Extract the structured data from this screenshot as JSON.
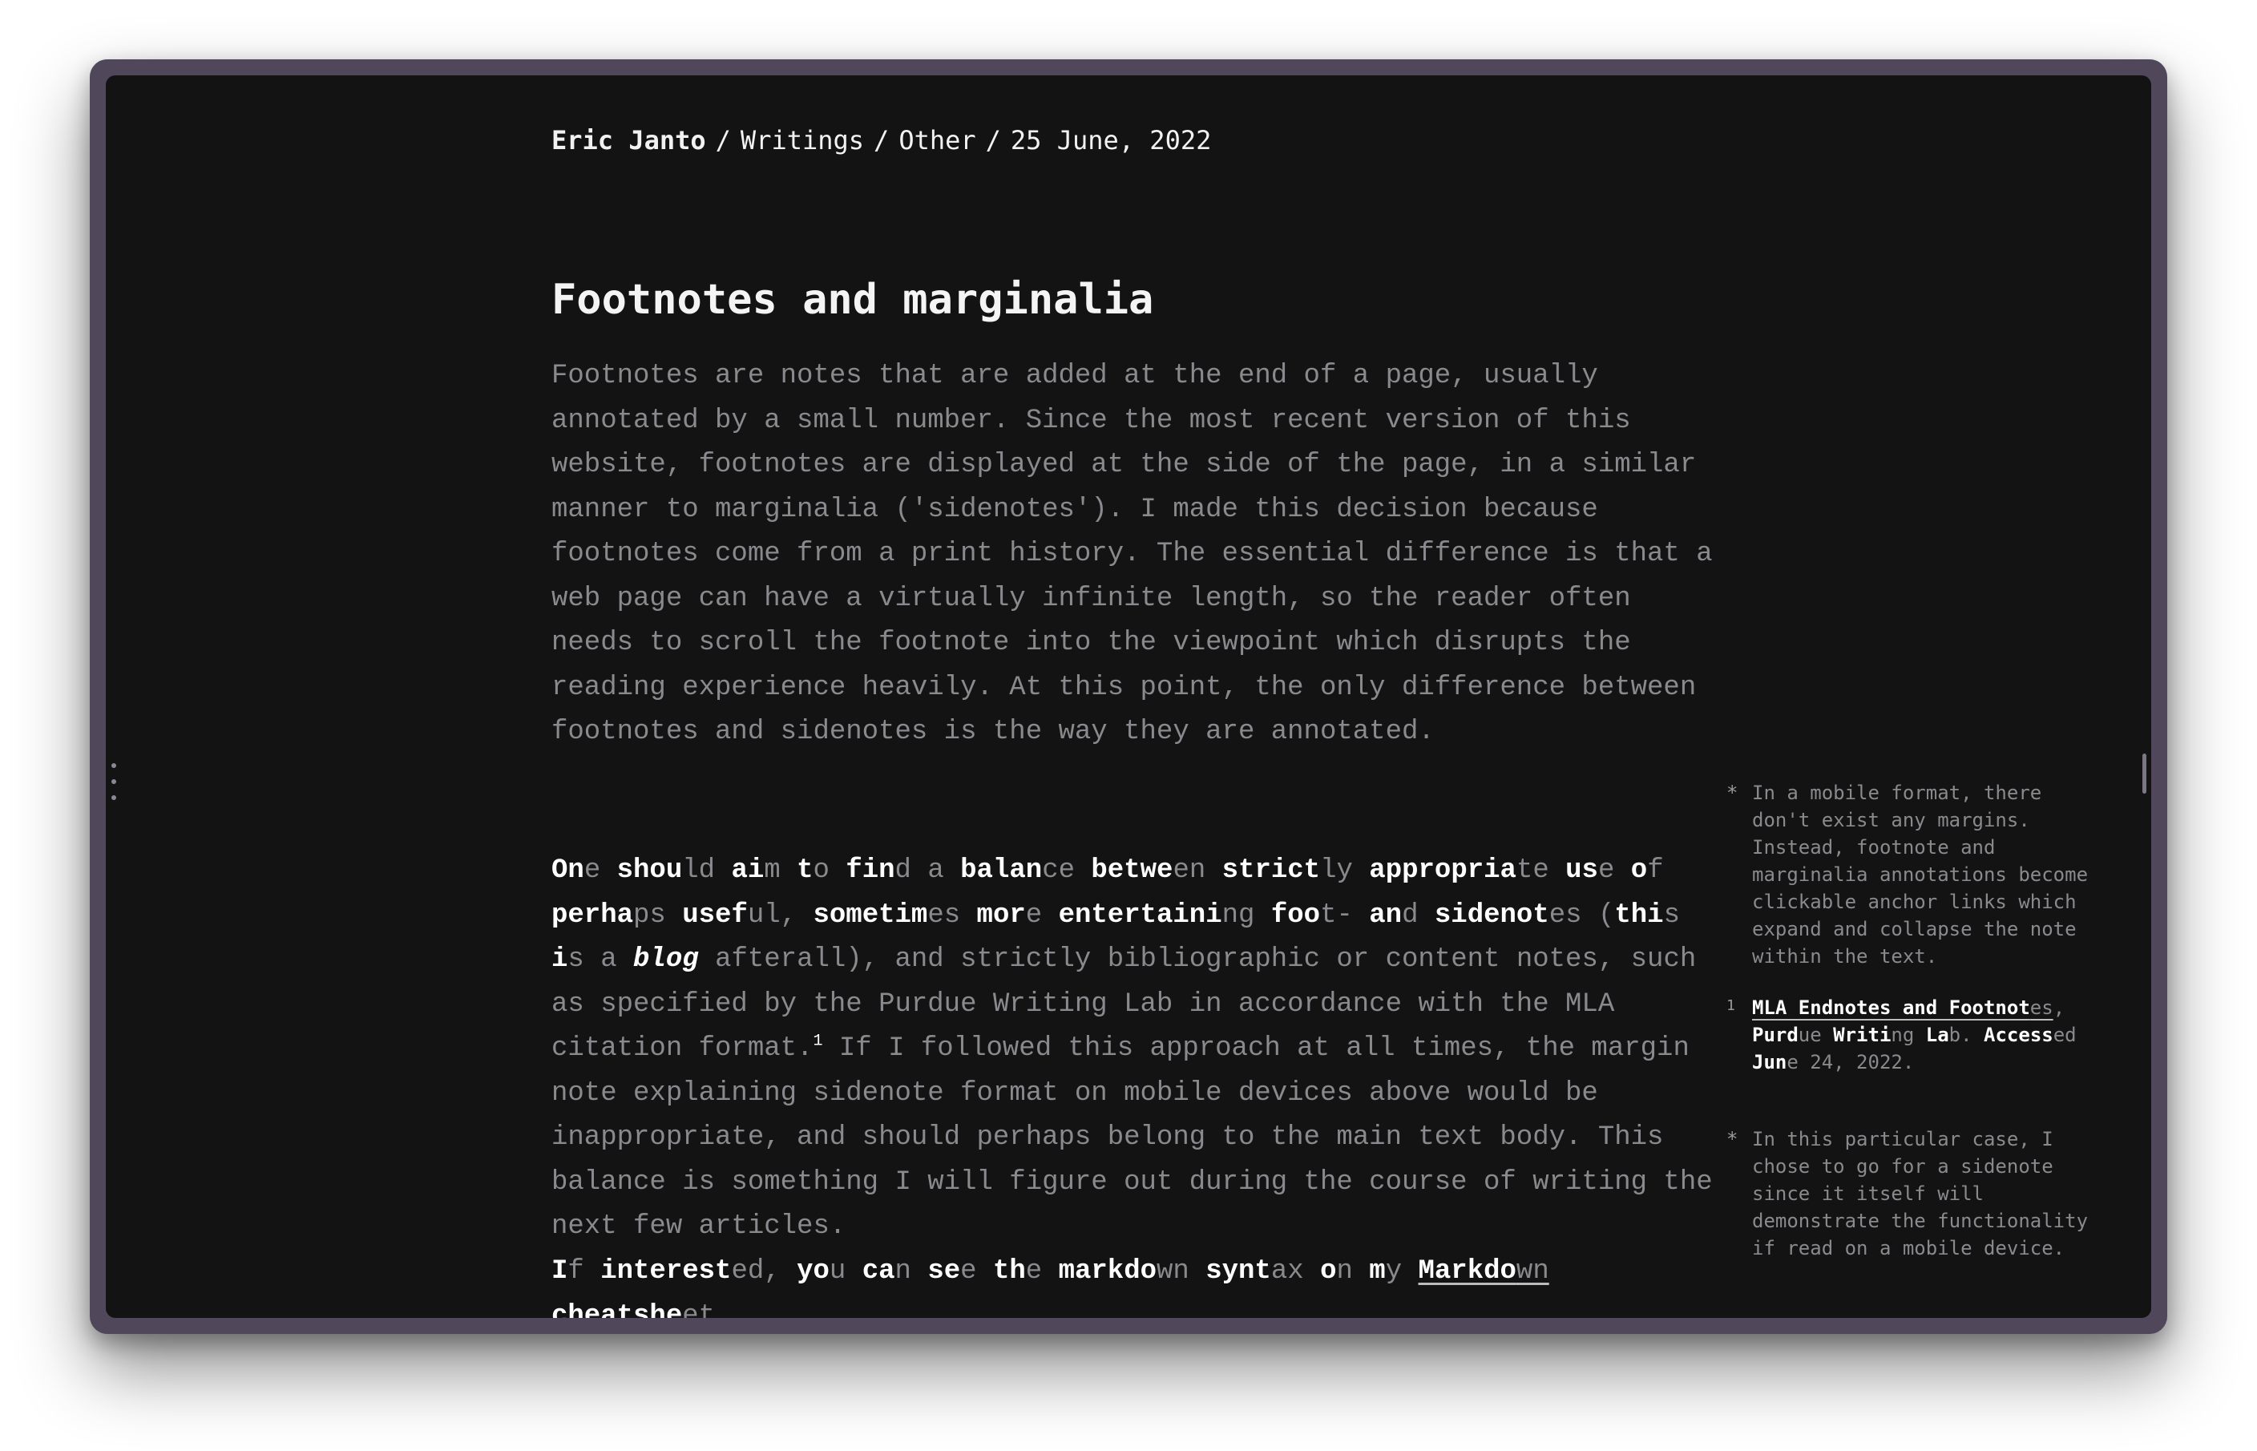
{
  "breadcrumb": {
    "author": "Eric Janto",
    "separator": "/",
    "section": "Writings",
    "category": "Other",
    "date": "25 June, 2022"
  },
  "article": {
    "title": "Footnotes and marginalia",
    "paragraph1": "Footnotes are notes that are added at the end of a page, usually annotated by a small number. Since the most recent version of this website, footnotes are displayed at the side of the page, in a similar manner to marginalia ('sidenotes'). I made this decision because footnotes come from a print history. The essential difference is that a web page can have a virtually infinite length, so the reader often needs to scroll the footnote into the viewpoint which disrupts the reading experience heavily. At this point, the only difference between footnotes and sidenotes is the way they are annotated.",
    "paragraph2_rest": "afterall), and strictly bibliographic or content notes, such as specified by the Purdue Writing Lab in accordance with the MLA citation format.",
    "footnote_ref": "1",
    "paragraph2_end": " If I followed this approach at all times, the margin note explaining sidenote format on mobile devices above would be inappropriate, and should perhaps belong to the main text body. This balance is something I will figure out during the course of writing the next few articles.",
    "link_text": "Markdown cheatsheet"
  },
  "margin_notes": {
    "note1_marker": "*",
    "note1": "In a mobile format, there don't exist any margins. Instead, footnote and marginalia annotations become clickable anchor links which expand and collapse the note within the text.",
    "note2_marker": "1",
    "note2_link": "MLA Endnotes and Footnotes",
    "note3_marker": "*",
    "note3": "In this particular case, I chose to go for a sidenote since it itself will demonstrate the functionality if read on a mobile device."
  },
  "colors": {
    "background": "#131314",
    "frame": "#50475a",
    "text_dim": "#8a8a8e",
    "text_bright": "#ffffff"
  }
}
